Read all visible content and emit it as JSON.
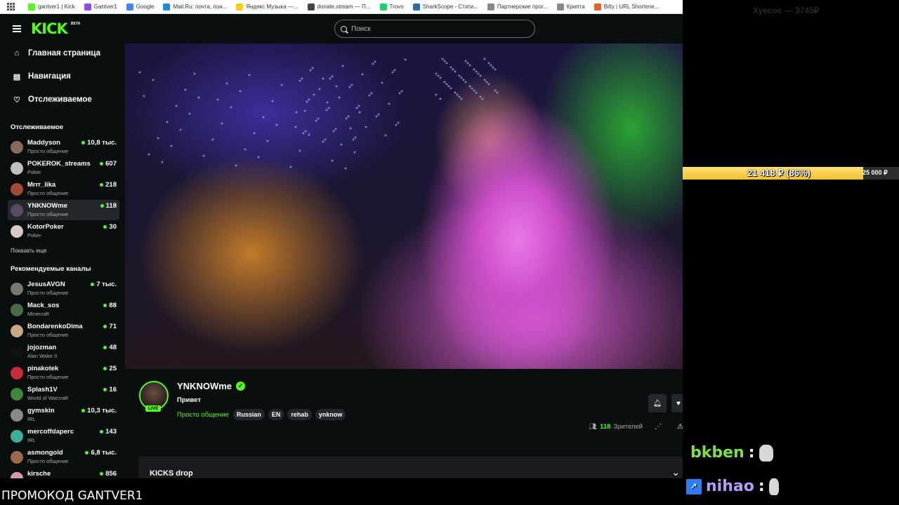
{
  "bookmarks": [
    {
      "label": "gantver1 | Kick",
      "color": "#53fc18"
    },
    {
      "label": "Gantver1",
      "color": "#9146ff"
    },
    {
      "label": "Google",
      "color": "#4285f4"
    },
    {
      "label": "Mail.Ru: почта, пои...",
      "color": "#1e88e5"
    },
    {
      "label": "Яндекс Музыка —...",
      "color": "#ffcc00"
    },
    {
      "label": "donate.stream — П...",
      "color": "#444444"
    },
    {
      "label": "Trovo",
      "color": "#19d66b"
    },
    {
      "label": "SharkScope - Стати...",
      "color": "#2b6cb0"
    },
    {
      "label": "Партнерские прог...",
      "color": "#888888"
    },
    {
      "label": "Крипта",
      "color": "#888888"
    },
    {
      "label": "Bitly | URL Shortene...",
      "color": "#ee6123"
    }
  ],
  "header": {
    "logo": "KICK",
    "logo_badge": "BETA",
    "search_placeholder": "Поиск"
  },
  "sidebar": {
    "nav": [
      {
        "label": "Главная страница",
        "icon": "home-icon"
      },
      {
        "label": "Навигация",
        "icon": "browse-icon"
      },
      {
        "label": "Отслеживаемое",
        "icon": "heart-icon"
      }
    ],
    "following_title": "Отслеживаемое",
    "following": [
      {
        "name": "Maddyson",
        "category": "Просто общение",
        "viewers": "10,8 тыс.",
        "color": "#8a6a5a"
      },
      {
        "name": "POKEROK_streams",
        "category": "Poker",
        "viewers": "607",
        "color": "#c0c0c0"
      },
      {
        "name": "Mrrr_lika",
        "category": "Просто общение",
        "viewers": "218",
        "color": "#a34a3a"
      },
      {
        "name": "YNKNOWme",
        "category": "Просто общение",
        "viewers": "118",
        "color": "#5a4a6a",
        "active": true
      },
      {
        "name": "KotorPoker",
        "category": "Poker",
        "viewers": "30",
        "color": "#d8c8c8"
      }
    ],
    "show_more": "Показать еще",
    "recommended_title": "Рекомендуемые каналы",
    "recommended": [
      {
        "name": "JesusAVGN",
        "category": "Просто общение",
        "viewers": "7 тыс.",
        "color": "#7a7a6a"
      },
      {
        "name": "Mack_sos",
        "category": "Minecraft",
        "viewers": "88",
        "color": "#4a6a4a"
      },
      {
        "name": "BondarenkoDima",
        "category": "Просто общение",
        "viewers": "71",
        "color": "#c8a888"
      },
      {
        "name": "jojozman",
        "category": "Alan Wake II",
        "viewers": "48",
        "color": "#111111"
      },
      {
        "name": "pinakotek",
        "category": "Просто общение",
        "viewers": "25",
        "color": "#c82a3a"
      },
      {
        "name": "Splash1V",
        "category": "World of Warcraft",
        "viewers": "16",
        "color": "#3a8a3a"
      },
      {
        "name": "gymskin",
        "category": "IRL",
        "viewers": "10,3 тыс.",
        "color": "#8a8a8a"
      },
      {
        "name": "mercoffdaperc",
        "category": "IRL",
        "viewers": "143",
        "color": "#3ab09a"
      },
      {
        "name": "asmongold",
        "category": "Просто общение",
        "viewers": "6,8 тыс.",
        "color": "#9a6a4a"
      },
      {
        "name": "kirsche",
        "category": "",
        "viewers": "856",
        "color": "#d89aa8"
      }
    ]
  },
  "stream": {
    "streamer": "YNKNOWme",
    "live_badge": "LIVE",
    "title": "Привет",
    "category": "Просто общение",
    "tags": [
      "Russian",
      "EN",
      "rehab",
      "ynknow"
    ],
    "viewer_count": "118",
    "viewer_label": "Зрителей",
    "kicks_label": "KICKS drop"
  },
  "overlay": {
    "top_donation": "Хуесос — 3745₽",
    "goal_text": "21 418 ₽ (86%)",
    "goal_max": "25 000 ₽",
    "goal_progress": 0.86,
    "chat": [
      {
        "user": "bkben",
        "separator": ":",
        "color": "#7fe043"
      },
      {
        "user": "nihao",
        "separator": ":",
        "color": "#b69cf6"
      }
    ],
    "promo": "ПРОМОКОД GANTVER1"
  }
}
